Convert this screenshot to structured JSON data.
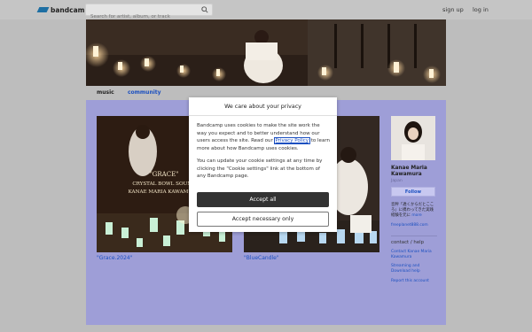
{
  "header": {
    "logo_text": "bandcamp",
    "search_placeholder": "Search for artist, album, or track",
    "signup": "sign up",
    "login": "log in"
  },
  "nav": {
    "tabs": [
      "music",
      "community"
    ]
  },
  "albums": [
    {
      "title": "\"Grace.2024\"",
      "cover_lines": [
        "\"GRACE\"",
        "CRYSTAL BOWL SOUND",
        "KANAE MARIA KAWAMURA"
      ]
    },
    {
      "title": "\"BlueCandle\""
    }
  ],
  "artist": {
    "name": "Kanae Maria Kawamura",
    "location": "Japan",
    "follow": "Follow",
    "bio": "音秤「透くからだとこころ」に携わってきた実践経験を元に",
    "more": "more",
    "website": "freeplanet888.com",
    "contact_heading": "contact / help",
    "links": [
      "Contact Kanae Maria Kawamura",
      "Streaming and Download help",
      "Report this account"
    ]
  },
  "cookie_modal": {
    "title": "We care about your privacy",
    "para1_before": "Bandcamp uses cookies to make the site work the way you expect and to better understand how our users access the site. Read our ",
    "privacy_link": "Privacy Policy",
    "para1_after": " to learn more about how Bandcamp uses cookies.",
    "para2": "You can update your cookie settings at any time by clicking the \"Cookie settings\" link at the bottom of any Bandcamp page.",
    "accept_all": "Accept all",
    "accept_necessary": "Accept necessary only"
  },
  "colors": {
    "content_bg": "#9e9ed7",
    "link": "#1a4fc0",
    "accept_bg": "#333333"
  }
}
